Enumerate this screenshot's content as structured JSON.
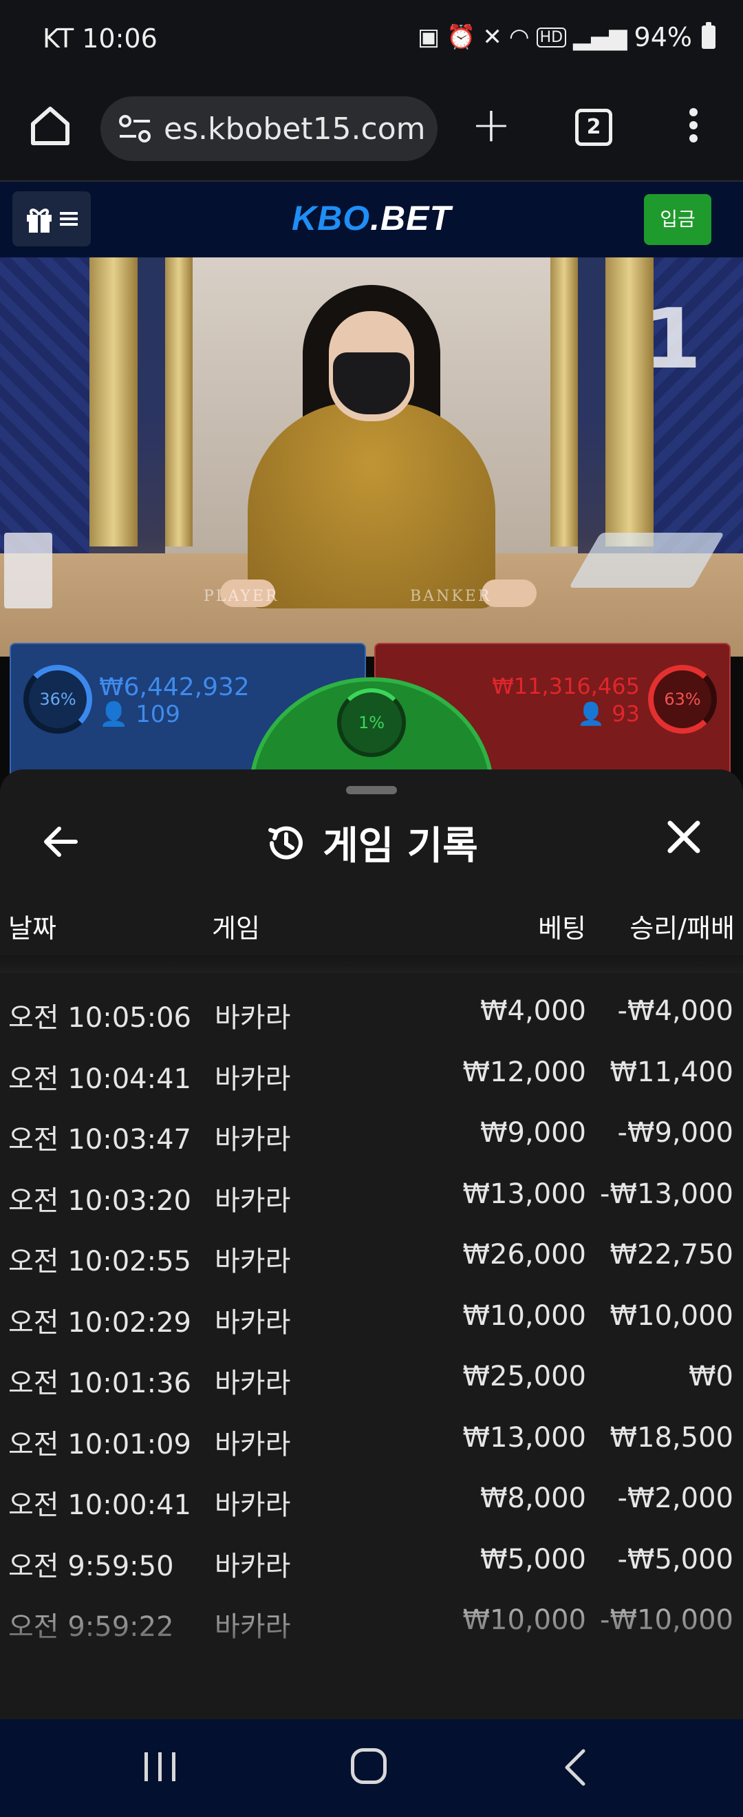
{
  "status_bar": {
    "carrier_time": "KT 10:06",
    "battery": "94%",
    "icons": [
      "power-saving-icon",
      "alarm-icon",
      "mute-icon",
      "wifi-icon",
      "hd-icon",
      "signal-icon",
      "battery-icon"
    ]
  },
  "browser": {
    "url": "es.kbobet15.com",
    "tab_count": "2"
  },
  "site_header": {
    "logo_main": "KBO",
    "logo_suffix": ".BET",
    "deposit_label": "입금"
  },
  "game": {
    "round_number": "1",
    "table_player_text": "PLAYER",
    "table_banker_text": "BANKER",
    "player": {
      "percent": "36%",
      "amount": "₩6,442,932",
      "count": "109"
    },
    "banker": {
      "percent": "63%",
      "amount": "₩11,316,465",
      "count": "93"
    },
    "tie": {
      "percent": "1%"
    }
  },
  "history": {
    "title": "게임 기록",
    "columns": {
      "date": "날짜",
      "game": "게임",
      "bet": "베팅",
      "result": "승리/패배"
    },
    "rows": [
      {
        "date": "오전 10:05:06",
        "game": "바카라",
        "bet": "₩4,000",
        "result": "-₩4,000"
      },
      {
        "date": "오전 10:04:41",
        "game": "바카라",
        "bet": "₩12,000",
        "result": "₩11,400"
      },
      {
        "date": "오전 10:03:47",
        "game": "바카라",
        "bet": "₩9,000",
        "result": "-₩9,000"
      },
      {
        "date": "오전 10:03:20",
        "game": "바카라",
        "bet": "₩13,000",
        "result": "-₩13,000"
      },
      {
        "date": "오전 10:02:55",
        "game": "바카라",
        "bet": "₩26,000",
        "result": "₩22,750"
      },
      {
        "date": "오전 10:02:29",
        "game": "바카라",
        "bet": "₩10,000",
        "result": "₩10,000"
      },
      {
        "date": "오전 10:01:36",
        "game": "바카라",
        "bet": "₩25,000",
        "result": "₩0"
      },
      {
        "date": "오전 10:01:09",
        "game": "바카라",
        "bet": "₩13,000",
        "result": "₩18,500"
      },
      {
        "date": "오전 10:00:41",
        "game": "바카라",
        "bet": "₩8,000",
        "result": "-₩2,000"
      },
      {
        "date": "오전 9:59:50",
        "game": "바카라",
        "bet": "₩5,000",
        "result": "-₩5,000"
      },
      {
        "date": "오전 9:59:22",
        "game": "바카라",
        "bet": "₩10,000",
        "result": "-₩10,000"
      }
    ]
  },
  "colors": {
    "player_blue": "#3f8bec",
    "banker_red": "#e0262c",
    "tie_green": "#1c8a2d",
    "deposit_green": "#1f9a2c",
    "logo_blue": "#1f8ef5",
    "header_navy": "#031030",
    "sheet_bg": "#1a1a1a"
  }
}
